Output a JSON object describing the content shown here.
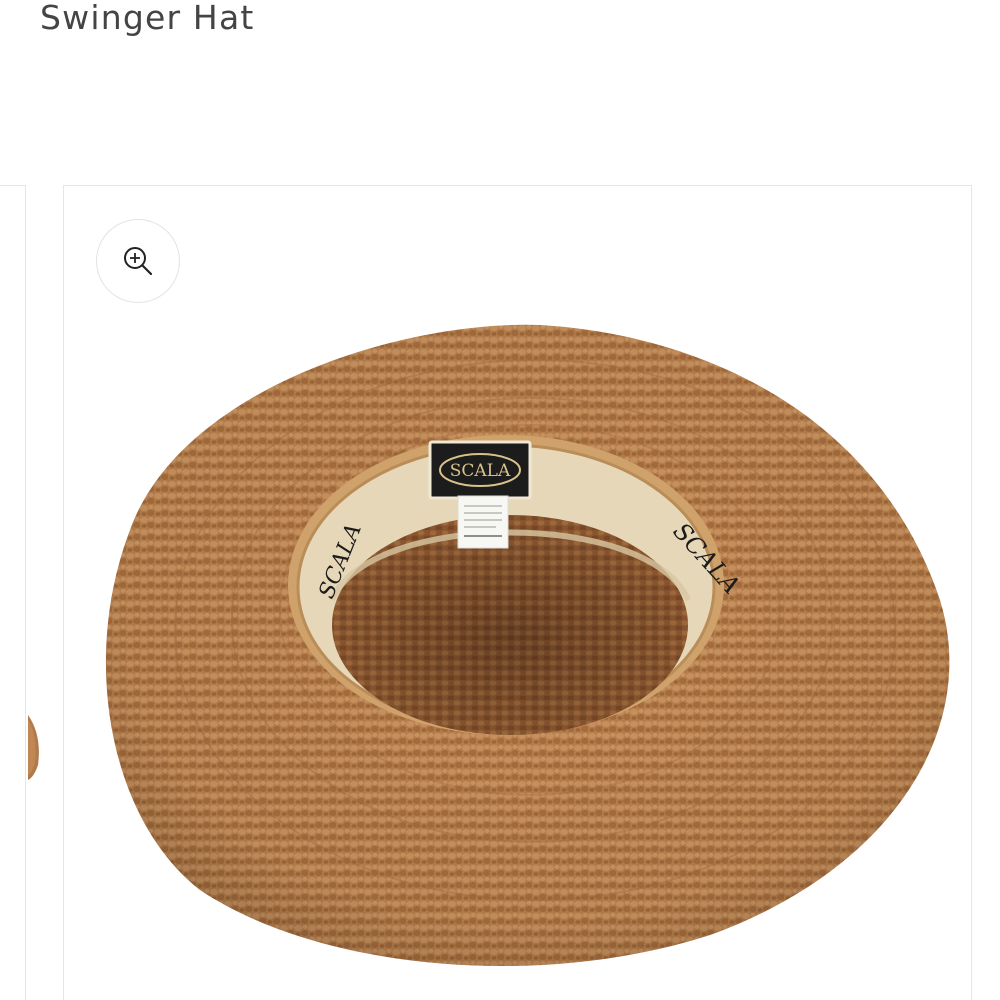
{
  "product": {
    "title": "Swinger Hat"
  },
  "gallery": {
    "zoom_icon": "zoom-in-icon",
    "main_image": {
      "brand_label": "SCALA",
      "brand_label_color": "#1c1c1c"
    }
  },
  "colors": {
    "title_text": "#444444",
    "border": "#e6e6e6",
    "straw_light": "#c48a56",
    "straw_dark": "#8a5630",
    "band_cream": "#e6d7b8"
  }
}
